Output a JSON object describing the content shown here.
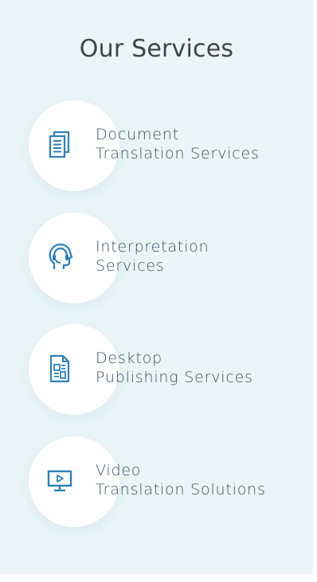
{
  "section": {
    "title": "Our Services"
  },
  "services": [
    {
      "icon": "document-icon",
      "line1": "Document",
      "line2": "Translation Services"
    },
    {
      "icon": "interpreter-headset-icon",
      "line1": "Interpretation",
      "line2": "Services"
    },
    {
      "icon": "desktop-publishing-icon",
      "line1": "Desktop",
      "line2": "Publishing Services"
    },
    {
      "icon": "video-monitor-icon",
      "line1": "Video",
      "line2": "Translation Solutions"
    }
  ],
  "colors": {
    "background": "#e9f5f7",
    "icon": "#2f7fb8",
    "title": "#3f4449",
    "label": "#3a4f63"
  }
}
